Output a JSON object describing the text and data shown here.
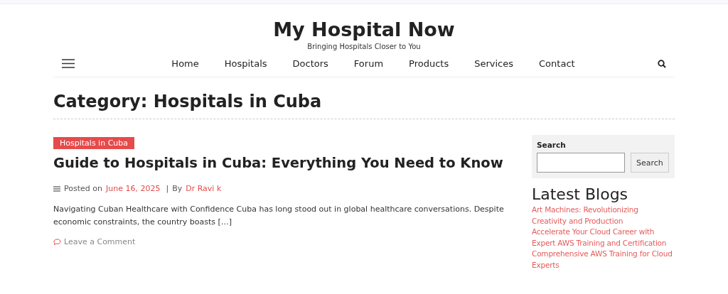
{
  "site": {
    "title": "My Hospital Now",
    "tagline": "Bringing Hospitals Closer to You"
  },
  "nav": {
    "items": [
      {
        "label": "Home"
      },
      {
        "label": "Hospitals"
      },
      {
        "label": "Doctors"
      },
      {
        "label": "Forum"
      },
      {
        "label": "Products"
      },
      {
        "label": "Services"
      },
      {
        "label": "Contact"
      }
    ]
  },
  "page_title": "Category: Hospitals in Cuba",
  "post": {
    "category": "Hospitals in Cuba",
    "title": "Guide to Hospitals in Cuba: Everything You Need to Know",
    "posted_label": "Posted on",
    "date": "June 16, 2025",
    "separator": "|",
    "by_label": "By",
    "author": "Dr Ravi k",
    "excerpt": "Navigating Cuban Healthcare with Confidence Cuba has long stood out in global healthcare conversations. Despite economic constraints, the country boasts […]",
    "comment_link": "Leave a Comment"
  },
  "sidebar": {
    "search": {
      "label": "Search",
      "button": "Search"
    },
    "latest_title": "Latest Blogs",
    "latest": [
      "Art Machines: Revolutionizing Creativity and Production",
      "Accelerate Your Cloud Career with Expert AWS Training and Certification",
      "Comprehensive AWS Training for Cloud Experts"
    ]
  }
}
